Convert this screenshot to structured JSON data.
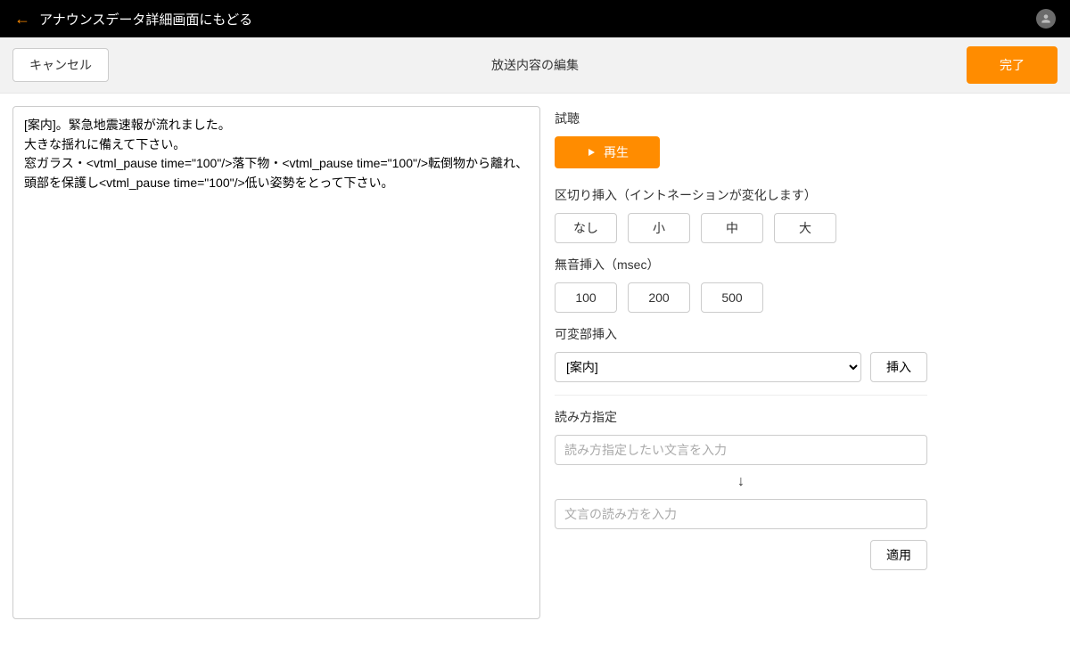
{
  "topbar": {
    "back_label": "アナウンスデータ詳細画面にもどる"
  },
  "subheader": {
    "cancel_label": "キャンセル",
    "title": "放送内容の編集",
    "done_label": "完了"
  },
  "editor": {
    "text": "[案内]。緊急地震速報が流れました。\n大きな揺れに備えて下さい。\n窓ガラス・<vtml_pause time=\"100\"/>落下物・<vtml_pause time=\"100\"/>転倒物から離れ、頭部を保護し<vtml_pause time=\"100\"/>低い姿勢をとって下さい。"
  },
  "side": {
    "preview_label": "試聴",
    "play_label": "再生",
    "separator_label": "区切り挿入（イントネーションが変化します）",
    "separator_buttons": {
      "none": "なし",
      "small": "小",
      "medium": "中",
      "large": "大"
    },
    "silence_label": "無音挿入（msec）",
    "silence_buttons": {
      "b100": "100",
      "b200": "200",
      "b500": "500"
    },
    "variable_label": "可変部挿入",
    "variable_selected": "[案内]",
    "insert_label": "挿入",
    "reading_label": "読み方指定",
    "reading_src_placeholder": "読み方指定したい文言を入力",
    "arrow": "↓",
    "reading_dst_placeholder": "文言の読み方を入力",
    "apply_label": "適用"
  }
}
